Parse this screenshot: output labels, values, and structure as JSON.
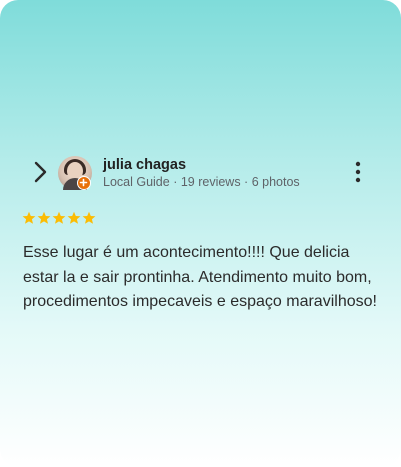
{
  "reviewer": {
    "name": "julia chagas",
    "title": "Local Guide",
    "separator1": " · ",
    "reviews": "19 reviews",
    "separator2": " · ",
    "photos": "6 photos"
  },
  "rating": {
    "stars": 5,
    "max": 5,
    "color": "#fbbc04"
  },
  "review": {
    "lines": [
      "Esse lugar é um acontecimento!!!! Que delicia",
      "estar la e sair prontinha. Atendimento muito bom,",
      "procedimentos impecaveis e espaço maravilhoso!"
    ]
  },
  "icons": {
    "back": "chevron-right-icon",
    "more": "more-vertical-icon",
    "badge": "local-guide-badge-icon"
  },
  "colors": {
    "gradient_top": "#7fdcda",
    "gradient_bottom": "#ffffff",
    "badge": "#e8710a"
  }
}
